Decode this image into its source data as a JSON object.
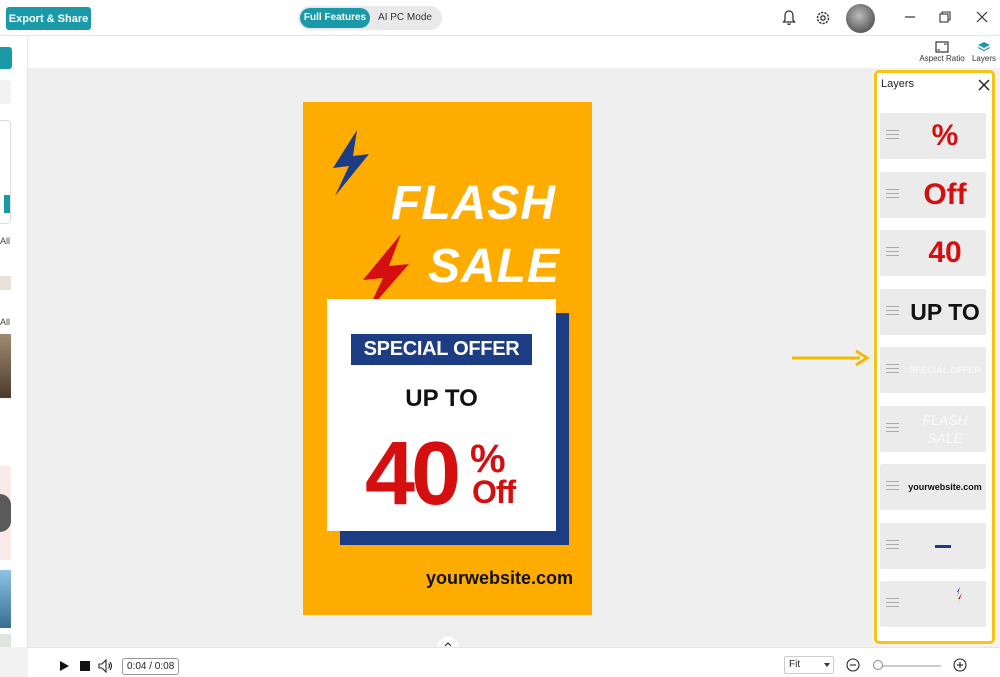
{
  "header": {
    "export_label": "Export & Share",
    "modes": {
      "active": "Full Features",
      "inactive": "AI PC Mode"
    }
  },
  "toolbar": {
    "aspect_ratio_label": "Aspect Ratio",
    "layers_label": "Layers"
  },
  "left_panel": {
    "filter_label_1": "All",
    "filter_label_2": "All"
  },
  "poster": {
    "headline_1": "FLASH",
    "headline_2": "SALE",
    "special": "SPECIAL OFFER",
    "up_to": "UP TO",
    "number": "40",
    "percent": "%",
    "off": "Off",
    "website": "yourwebsite.com",
    "colors": {
      "background": "#ffac00",
      "navy": "#1c3c84",
      "red": "#d50f0f"
    }
  },
  "layers_panel": {
    "title": "Layers",
    "items": [
      {
        "name": "%",
        "kind": "text-red"
      },
      {
        "name": "Off",
        "kind": "text-red"
      },
      {
        "name": "40",
        "kind": "text-red"
      },
      {
        "name": "UP TO",
        "kind": "text-black"
      },
      {
        "name": "SPECIAL OFFER",
        "kind": "text-faint"
      },
      {
        "name": "FLASH SALE",
        "kind": "text-white"
      },
      {
        "name": "yourwebsite.com",
        "kind": "text-black-small"
      },
      {
        "name": "",
        "kind": "shape-line"
      },
      {
        "name": "",
        "kind": "shape-bolts"
      }
    ]
  },
  "playback": {
    "time": "0:04 / 0:08",
    "zoom_mode": "Fit"
  },
  "accent_color": "#1a9aa8",
  "highlight_color": "#f5c518"
}
